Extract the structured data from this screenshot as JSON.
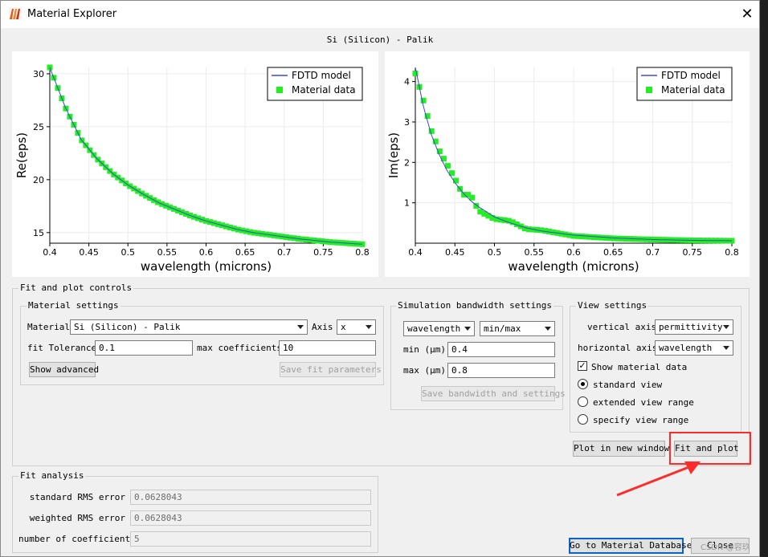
{
  "window": {
    "title": "Material Explorer",
    "close_glyph": "✕",
    "icon": "lumerical-app-icon"
  },
  "plot_title": "Si (Silicon) - Palik",
  "legend": {
    "model_label": "FDTD model",
    "data_label": "Material data"
  },
  "colors": {
    "model_line": "#3f48cc",
    "data_marker": "#22ee22",
    "highlight": "#ff2a2a"
  },
  "chart_data": [
    {
      "type": "line",
      "xlabel": "wavelength (microns)",
      "ylabel": "Re(eps)",
      "xlim": [
        0.4,
        0.8
      ],
      "ylim": [
        14,
        30.6
      ],
      "xticks": [
        "0.4",
        "0.45",
        "0.5",
        "0.55",
        "0.6",
        "0.65",
        "0.7",
        "0.75",
        "0.8"
      ],
      "yticks": [
        "15",
        "20",
        "25",
        "30"
      ],
      "grid": true,
      "legend_position": "top-right",
      "series": [
        {
          "name": "FDTD model",
          "x": [
            0.4,
            0.42,
            0.44,
            0.46,
            0.48,
            0.5,
            0.52,
            0.54,
            0.56,
            0.58,
            0.6,
            0.62,
            0.64,
            0.66,
            0.68,
            0.7,
            0.72,
            0.74,
            0.76,
            0.78,
            0.8
          ],
          "y": [
            30.6,
            26.8,
            23.8,
            22.0,
            20.6,
            19.5,
            18.6,
            17.8,
            17.2,
            16.6,
            16.1,
            15.7,
            15.3,
            15.0,
            14.8,
            14.6,
            14.4,
            14.25,
            14.1,
            14.0,
            13.9
          ]
        },
        {
          "name": "Material data",
          "x": [
            0.4,
            0.42,
            0.44,
            0.46,
            0.48,
            0.5,
            0.52,
            0.54,
            0.56,
            0.58,
            0.6,
            0.62,
            0.64,
            0.66,
            0.68,
            0.7,
            0.72,
            0.74,
            0.76,
            0.78,
            0.8
          ],
          "y": [
            30.6,
            26.8,
            23.8,
            22.0,
            20.6,
            19.5,
            18.6,
            17.8,
            17.2,
            16.6,
            16.1,
            15.7,
            15.3,
            15.0,
            14.8,
            14.6,
            14.4,
            14.25,
            14.1,
            14.0,
            13.9
          ]
        }
      ]
    },
    {
      "type": "line",
      "xlabel": "wavelength (microns)",
      "ylabel": "Im(eps)",
      "xlim": [
        0.4,
        0.8
      ],
      "ylim": [
        0,
        4.35
      ],
      "xticks": [
        "0.4",
        "0.45",
        "0.5",
        "0.55",
        "0.6",
        "0.65",
        "0.7",
        "0.75",
        "0.8"
      ],
      "yticks": [
        "1",
        "2",
        "3",
        "4"
      ],
      "grid": true,
      "legend_position": "top-right",
      "series": [
        {
          "name": "FDTD model",
          "x": [
            0.4,
            0.41,
            0.42,
            0.43,
            0.44,
            0.45,
            0.46,
            0.47,
            0.48,
            0.5,
            0.52,
            0.54,
            0.56,
            0.6,
            0.65,
            0.7,
            0.75,
            0.8
          ],
          "y": [
            4.35,
            3.4,
            2.7,
            2.2,
            1.8,
            1.5,
            1.25,
            1.05,
            0.9,
            0.65,
            0.5,
            0.38,
            0.3,
            0.2,
            0.13,
            0.09,
            0.07,
            0.06
          ]
        },
        {
          "name": "Material data",
          "x": [
            0.4,
            0.41,
            0.42,
            0.43,
            0.44,
            0.45,
            0.46,
            0.47,
            0.48,
            0.5,
            0.52,
            0.54,
            0.56,
            0.6,
            0.65,
            0.7,
            0.75,
            0.8
          ],
          "y": [
            4.2,
            3.55,
            2.8,
            2.3,
            1.95,
            1.6,
            1.2,
            1.2,
            0.8,
            0.6,
            0.55,
            0.35,
            0.32,
            0.18,
            0.12,
            0.09,
            0.07,
            0.06
          ]
        }
      ]
    }
  ],
  "fit_controls": {
    "group_label": "Fit and plot controls",
    "material_settings": {
      "group_label": "Material settings",
      "material_label": "Material",
      "material_value": "Si (Silicon) - Palik",
      "axis_label": "Axis",
      "axis_value": "x",
      "fit_tolerance_label": "fit Tolerance",
      "fit_tolerance_value": "0.1",
      "max_coefficients_label": "max coefficients",
      "max_coefficients_value": "10",
      "show_advanced_label": "Show advanced",
      "save_fit_label": "Save fit parameters"
    },
    "simulation_bandwidth": {
      "group_label": "Simulation bandwidth settings",
      "unit_select": "wavelength",
      "range_select": "min/max",
      "min_label": "min (μm)",
      "min_value": "0.4",
      "max_label": "max (μm)",
      "max_value": "0.8",
      "save_label": "Save bandwidth and settings"
    },
    "view_settings": {
      "group_label": "View settings",
      "vertical_axis_label": "vertical axis",
      "vertical_axis_value": "permittivity",
      "horizontal_axis_label": "horizontal axis",
      "horizontal_axis_value": "wavelength",
      "show_material_data_label": "Show material data",
      "show_material_data_checked": true,
      "standard_view_label": "standard view",
      "extended_view_label": "extended view range",
      "specify_view_label": "specify view range",
      "selected_view": "standard view"
    },
    "plot_new_window_label": "Plot in new window",
    "fit_and_plot_label": "Fit and plot"
  },
  "fit_analysis": {
    "group_label": "Fit analysis",
    "standard_rms_label": "standard RMS error",
    "standard_rms_value": "0.0628043",
    "weighted_rms_label": "weighted RMS error",
    "weighted_rms_value": "0.0628043",
    "num_coefficients_label": "number of coefficients",
    "num_coefficients_value": "5"
  },
  "footer": {
    "go_to_db_label": "Go to Material Database",
    "close_label": "Close"
  },
  "watermark": "CSDN @容玖"
}
